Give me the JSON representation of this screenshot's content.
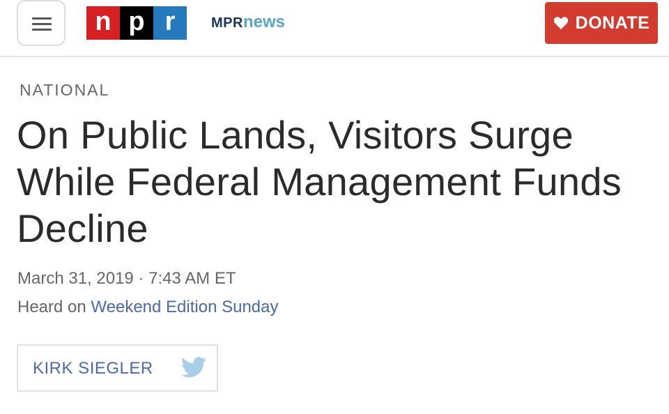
{
  "header": {
    "logo": {
      "letters": [
        "n",
        "p",
        "r"
      ],
      "colors": [
        "#d62021",
        "#000000",
        "#237bbd"
      ]
    },
    "station": {
      "mpr": "MPR",
      "news": "news"
    },
    "donate_label": "DONATE",
    "colors": {
      "donate_bg": "#d13c2f"
    }
  },
  "article": {
    "section": "NATIONAL",
    "headline": "On Public Lands, Visitors Surge While Federal Management Funds Decline",
    "dateline": "March 31, 2019 · 7:43 AM ET",
    "heard_prefix": "Heard on ",
    "program": "Weekend Edition Sunday",
    "author": "KIRK SIEGLER"
  },
  "icons": [
    "menu-icon",
    "heart-icon",
    "twitter-icon"
  ]
}
